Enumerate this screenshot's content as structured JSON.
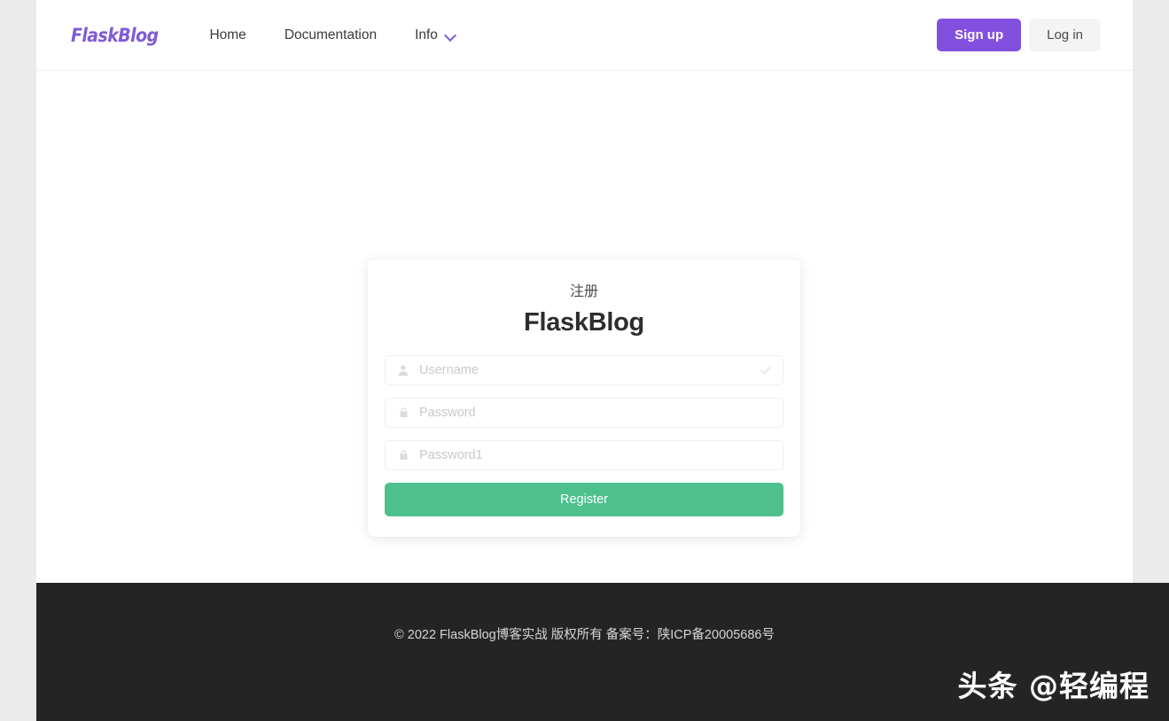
{
  "navbar": {
    "brand": "FlaskBlog",
    "links": [
      {
        "label": "Home",
        "name": "nav-link-home"
      },
      {
        "label": "Documentation",
        "name": "nav-link-documentation"
      },
      {
        "label": "Info",
        "name": "nav-link-info",
        "icon": "chevron-down-icon"
      }
    ],
    "signup_label": "Sign up",
    "login_label": "Log in",
    "brand_color": "#7f5bd6",
    "signup_bg": "#8250df",
    "login_bg": "#f4f4f5"
  },
  "card": {
    "subtitle": "注册",
    "title": "FlaskBlog",
    "fields": [
      {
        "name": "username-field",
        "placeholder": "Username",
        "value": "",
        "icon": "user-icon",
        "trailing_icon": "check-icon",
        "type": "text"
      },
      {
        "name": "password-field",
        "placeholder": "Password",
        "value": "",
        "icon": "lock-icon",
        "trailing_icon": "",
        "type": "password"
      },
      {
        "name": "password-confirm-field",
        "placeholder": "Password1",
        "value": "",
        "icon": "lock-icon",
        "trailing_icon": "",
        "type": "password"
      }
    ],
    "submit_label": "Register",
    "submit_color": "#4ec08c"
  },
  "footer": {
    "text": "© 2022 FlaskBlog博客实战 版权所有 备案号：陕ICP备20005686号",
    "bg": "#242424"
  },
  "watermark": {
    "text": "头条 @轻编程"
  }
}
